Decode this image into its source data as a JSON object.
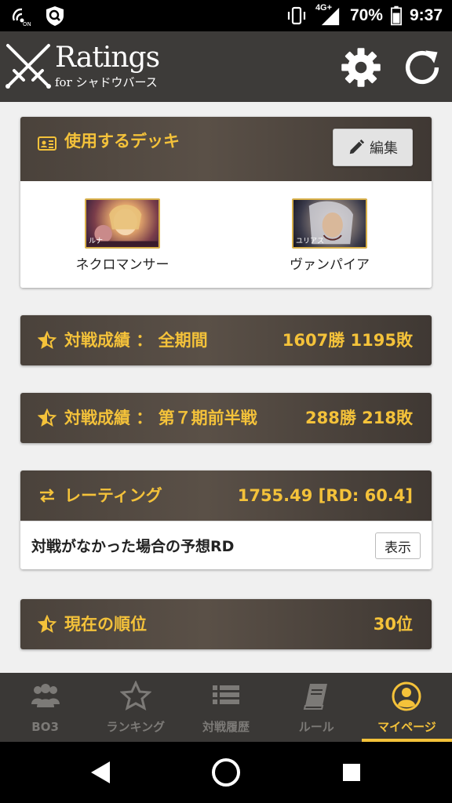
{
  "status_bar": {
    "network_label": "4G+",
    "battery": "70%",
    "time": "9:37",
    "icons": [
      "nfc-icon",
      "shield-app-icon",
      "vibrate-icon",
      "signal-icon",
      "battery-icon"
    ]
  },
  "app_bar": {
    "title": "Ratings",
    "subtitle": "for シャドウバース",
    "actions": [
      "gear-icon",
      "refresh-icon"
    ]
  },
  "deck_card": {
    "title": "使用するデッキ",
    "edit_label": "編集",
    "decks": [
      {
        "name": "ネクロマンサー",
        "thumb_caption": "ルナ"
      },
      {
        "name": "ヴァンパイア",
        "thumb_caption": "ユリアス"
      }
    ]
  },
  "record_all": {
    "title": "対戦成績 ： 全期間",
    "value": "1607勝 1195敗"
  },
  "record_season": {
    "title": "対戦成績 ： 第７期前半戦",
    "value": "288勝 218敗"
  },
  "rating_card": {
    "title": "レーティング",
    "value": "1755.49 [RD: 60.4]",
    "row_label": "対戦がなかった場合の予想RD",
    "show_label": "表示"
  },
  "rank_card": {
    "title": "現在の順位",
    "value": "30位"
  },
  "bottom_nav": {
    "items": [
      {
        "label": "BO3",
        "icon": "group-icon"
      },
      {
        "label": "ランキング",
        "icon": "star-icon"
      },
      {
        "label": "対戦履歴",
        "icon": "list-icon"
      },
      {
        "label": "ルール",
        "icon": "book-icon"
      },
      {
        "label": "マイページ",
        "icon": "user-circle-icon"
      }
    ],
    "active_index": 4
  },
  "colors": {
    "accent": "#f4c23a",
    "app_bar": "#3d3b39",
    "background": "#f0f0f0",
    "nav_inactive": "#7c7a77"
  }
}
